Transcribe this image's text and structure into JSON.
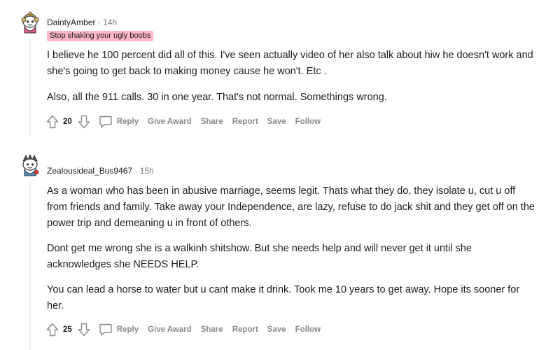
{
  "colors": {
    "flair_bg": "#ffb6c7",
    "meta_gray": "#7c7c7c",
    "action_gray": "#878a8c",
    "text": "#1c1c1c"
  },
  "comments": [
    {
      "author": "DaintyAmber",
      "separator": "·",
      "time": "14h",
      "flair": "Stop shaking your ugly boobs",
      "paragraphs": [
        "I believe he 100 percent did all of this. I've seen actually video of her also talk about hiw he doesn't work and she's going to get back to making money cause he won't. Etc .",
        "Also, all the 911 calls. 30 in one year. That's not normal. Somethings wrong."
      ],
      "score": "20",
      "actions": {
        "reply": "Reply",
        "award": "Give Award",
        "share": "Share",
        "report": "Report",
        "save": "Save",
        "follow": "Follow"
      },
      "avatar_icon": "snoo-avatar-icon"
    },
    {
      "author": "Zealousideal_Bus9467",
      "separator": "·",
      "time": "15h",
      "paragraphs": [
        "As a woman who has been in abusive marriage, seems legit. Thats what they do, they isolate u, cut u off from friends and family. Take away your Independence, are lazy, refuse to do jack shit and they get off on the power trip and demeaning u in front of others.",
        "Dont get me wrong she is a walkinh shitshow. But she needs help and will never get it until she acknowledges she NEEDS HELP.",
        "You can lead a horse to water but u cant make it drink. Took me 10 years to get away. Hope its sooner for her."
      ],
      "score": "25",
      "actions": {
        "reply": "Reply",
        "award": "Give Award",
        "share": "Share",
        "report": "Report",
        "save": "Save",
        "follow": "Follow"
      },
      "avatar_icon": "snoo-avatar-icon"
    }
  ]
}
